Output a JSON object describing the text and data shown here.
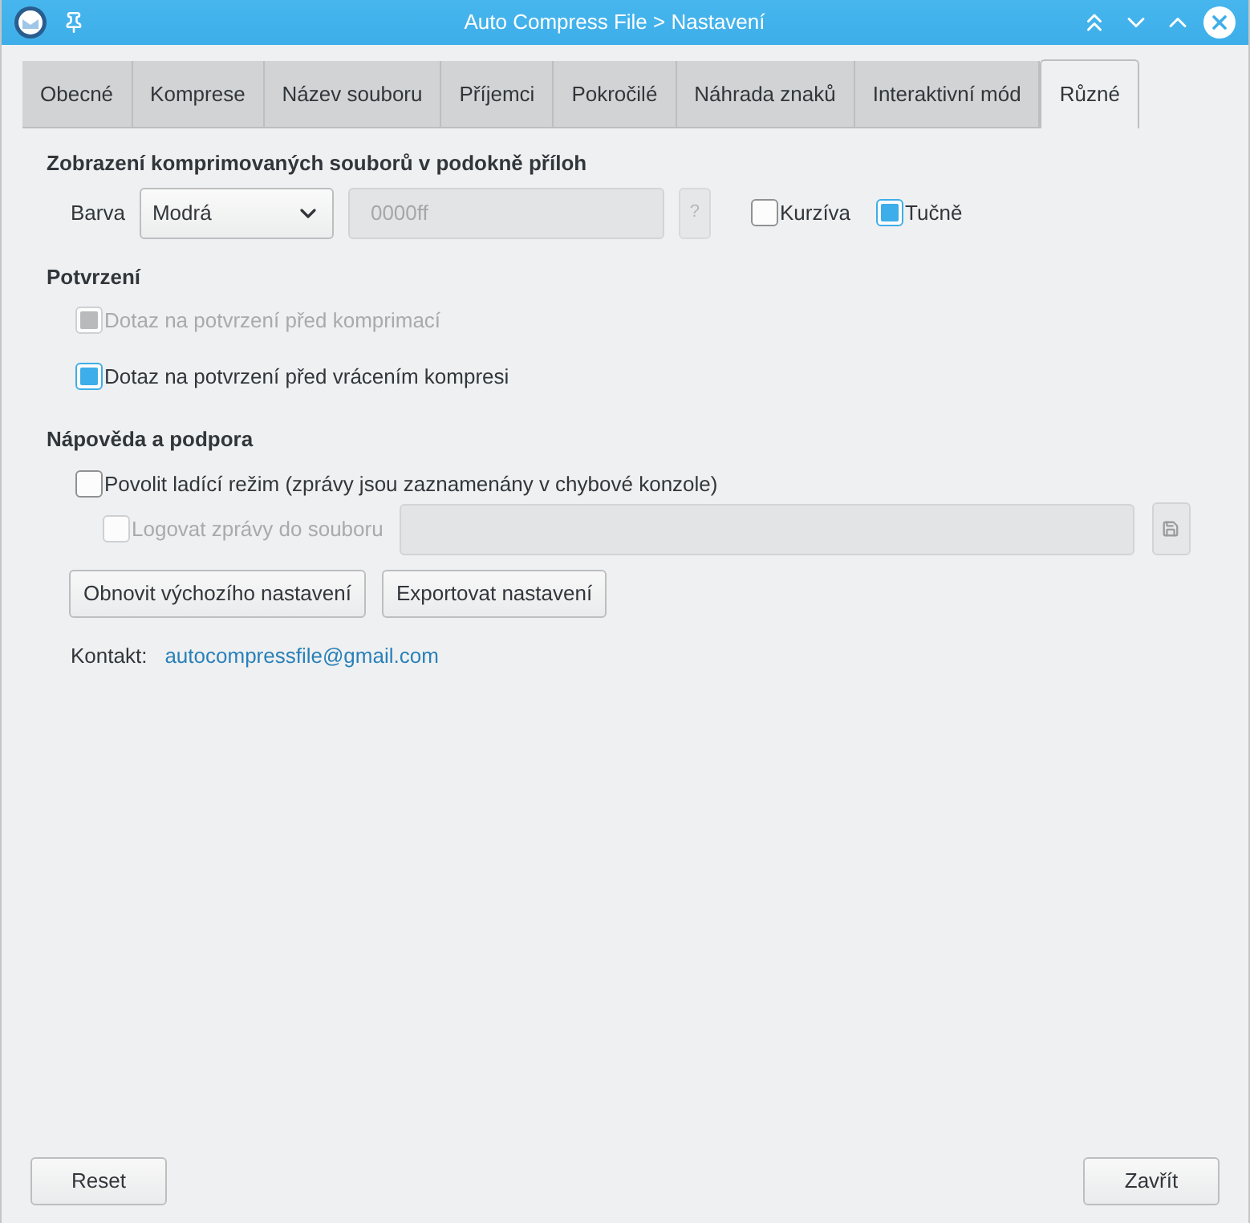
{
  "window": {
    "title": "Auto Compress File > Nastavení"
  },
  "tabs": [
    {
      "label": "Obecné",
      "selected": false
    },
    {
      "label": "Komprese",
      "selected": false
    },
    {
      "label": "Název souboru",
      "selected": false
    },
    {
      "label": "Příjemci",
      "selected": false
    },
    {
      "label": "Pokročilé",
      "selected": false
    },
    {
      "label": "Náhrada znaků",
      "selected": false
    },
    {
      "label": "Interaktivní mód",
      "selected": false
    },
    {
      "label": "Různé",
      "selected": true
    }
  ],
  "display_section": {
    "heading": "Zobrazení komprimovaných souborů v podokně příloh",
    "color_label": "Barva",
    "color_select": {
      "value": "Modrá"
    },
    "color_code": {
      "value": "0000ff",
      "disabled": true
    },
    "help_button": {
      "label": "?",
      "disabled": true
    },
    "options": [
      {
        "label": "Kurzíva",
        "checked": false
      },
      {
        "label": "Tučně",
        "checked": true
      }
    ]
  },
  "confirmation_section": {
    "heading": "Potvrzení",
    "options": [
      {
        "label": "Dotaz na potvrzení před komprimací",
        "checked": true,
        "disabled": true
      },
      {
        "label": "Dotaz na potvrzení před vrácením kompresi",
        "checked": true,
        "disabled": false
      }
    ]
  },
  "help_section": {
    "heading": "Nápověda a podpora",
    "debug_mode": {
      "label": "Povolit ladící režim (zprávy jsou zaznamenány v chybové konzole)",
      "checked": false,
      "disabled": false
    },
    "log_to_file": {
      "label": "Logovat zprávy do souboru",
      "checked": false,
      "disabled": true
    },
    "log_path": {
      "disabled": true
    },
    "save_button": {
      "disabled": true
    },
    "buttons": [
      "Obnovit výchozího nastavení",
      "Exportovat nastavení"
    ],
    "contact_label": "Kontakt:",
    "contact_link": "autocompressfile@gmail.com"
  },
  "footer_buttons": [
    "Reset",
    "Zavřít"
  ]
}
